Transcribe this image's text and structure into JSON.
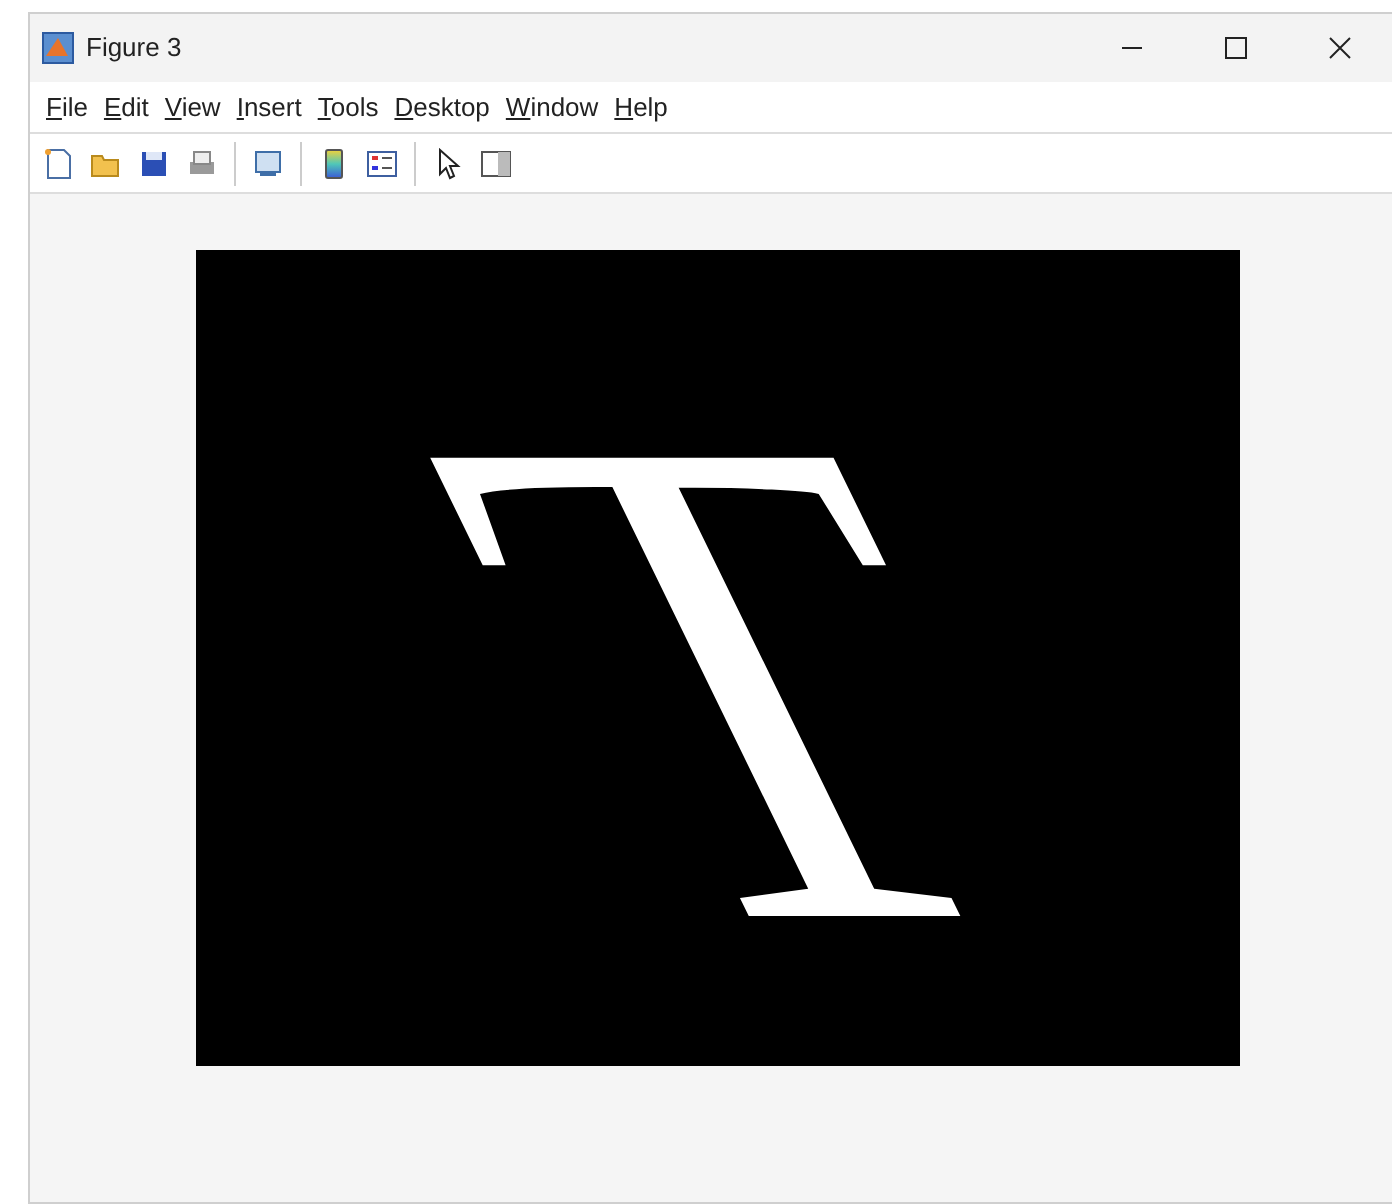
{
  "window": {
    "title": "Figure 3"
  },
  "menu": [
    "File",
    "Edit",
    "View",
    "Insert",
    "Tools",
    "Desktop",
    "Window",
    "Help"
  ],
  "toolbar": [
    {
      "kind": "new"
    },
    {
      "kind": "open"
    },
    {
      "kind": "save"
    },
    {
      "kind": "print"
    },
    {
      "kind": "sep"
    },
    {
      "kind": "link"
    },
    {
      "kind": "sep"
    },
    {
      "kind": "colorbar"
    },
    {
      "kind": "legend"
    },
    {
      "kind": "sep"
    },
    {
      "kind": "pointer"
    },
    {
      "kind": "panel"
    }
  ],
  "image": {
    "text": "T"
  }
}
